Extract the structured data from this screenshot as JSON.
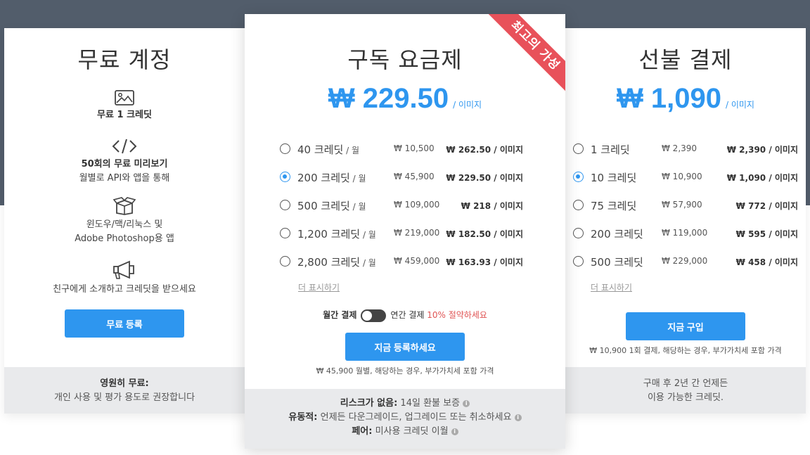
{
  "currency_symbol": "₩",
  "colors": {
    "accent": "#2e96ef",
    "ribbon": "#e8515a",
    "save": "#e05454",
    "band": "#525d6b"
  },
  "free": {
    "title": "무료 계정",
    "features": [
      {
        "icon": "image-icon",
        "bold": "무료 1 크레딧",
        "text": ""
      },
      {
        "icon": "code-icon",
        "bold": "50회의 무료 미리보기",
        "text": "월별로 API와 앱을 통해"
      },
      {
        "icon": "box-icon",
        "bold": "",
        "text": "윈도우/맥/리눅스 및",
        "text2": "Adobe Photoshop용 앱"
      },
      {
        "icon": "megaphone-icon",
        "bold": "",
        "text": "친구에게 소개하고 크레딧을 받으세요"
      }
    ],
    "button": "무료 등록",
    "footer_bold": "영원히 무료:",
    "footer_text": "개인 사용 및 평가 용도로 권장합니다"
  },
  "subscription": {
    "title": "구독 요금제",
    "ribbon": "최고의 가성",
    "price": "₩ 229.50",
    "per": "/ 이미지",
    "options": [
      {
        "label": "40 크레딧",
        "unit": " / 월",
        "orig": "₩ 10,500",
        "price": "₩ 262.50 / 이미지",
        "selected": false
      },
      {
        "label": "200 크레딧",
        "unit": " / 월",
        "orig": "₩ 45,900",
        "price": "₩ 229.50 / 이미지",
        "selected": true
      },
      {
        "label": "500 크레딧",
        "unit": " / 월",
        "orig": "₩ 109,000",
        "price": "₩ 218 / 이미지",
        "selected": false
      },
      {
        "label": "1,200 크레딧",
        "unit": " / 월",
        "orig": "₩ 219,000",
        "price": "₩ 182.50 / 이미지",
        "selected": false
      },
      {
        "label": "2,800 크레딧",
        "unit": " / 월",
        "orig": "₩ 459,000",
        "price": "₩ 163.93 / 이미지",
        "selected": false
      }
    ],
    "more": "더 표시하기",
    "toggle_monthly": "월간 결제",
    "toggle_yearly": "연간 결제",
    "toggle_save": "10% 절약하세요",
    "button": "지금 등록하세요",
    "note": "₩ 45,900 월별, 해당하는 경우, 부가가치세 포함 가격",
    "footer": [
      {
        "bold": "리스크가 없음:",
        "text": " 14일 환불 보증"
      },
      {
        "bold": "유동적:",
        "text": " 언제든 다운그레이드, 업그레이드 또는 취소하세요"
      },
      {
        "bold": "페어:",
        "text": " 미사용 크레딧 이월"
      }
    ]
  },
  "prepaid": {
    "title": "선불 결제",
    "price": "₩ 1,090",
    "per": "/ 이미지",
    "options": [
      {
        "label": "1 크레딧",
        "orig": "₩ 2,390",
        "price": "₩ 2,390 / 이미지",
        "selected": false
      },
      {
        "label": "10 크레딧",
        "orig": "₩ 10,900",
        "price": "₩ 1,090 / 이미지",
        "selected": true
      },
      {
        "label": "75 크레딧",
        "orig": "₩ 57,900",
        "price": "₩ 772 / 이미지",
        "selected": false
      },
      {
        "label": "200 크레딧",
        "orig": "₩ 119,000",
        "price": "₩ 595 / 이미지",
        "selected": false
      },
      {
        "label": "500 크레딧",
        "orig": "₩ 229,000",
        "price": "₩ 458 / 이미지",
        "selected": false
      }
    ],
    "more": "더 표시하기",
    "button": "지금 구입",
    "note": "₩ 10,900 1회 결제, 해당하는 경우, 부가가치세 포함 가격",
    "footer_line1": "구매 후 2년 간 언제든",
    "footer_line2": "이용 가능한 크레딧."
  }
}
